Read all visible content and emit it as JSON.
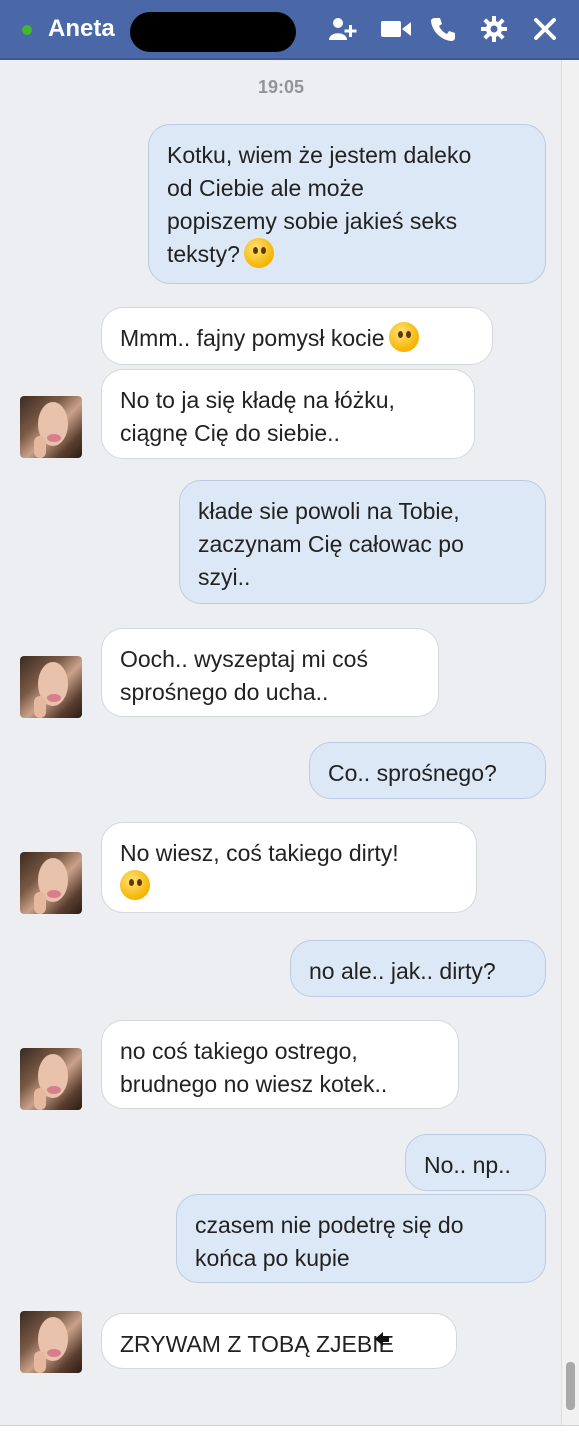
{
  "header": {
    "contact_name": "Aneta",
    "status": "online",
    "icons": [
      "add-people-icon",
      "video-call-icon",
      "phone-icon",
      "gear-icon",
      "close-icon"
    ]
  },
  "conversation": {
    "timestamp": "19:05",
    "messages": [
      {
        "from": "me",
        "text": "Kotku, wiem że jestem daleko\nod Ciebie ale może\npopiszemy sobie jakieś seks\nteksty?",
        "emoji": "wink"
      },
      {
        "from": "them",
        "text": "Mmm.. fajny pomysł kocie",
        "emoji": "kiss"
      },
      {
        "from": "them",
        "text": "No to ja się kładę na łóżku,\nciągnę Cię do siebie.."
      },
      {
        "from": "me",
        "text": "kłade sie powoli na Tobie,\nzaczynam Cię całowac po\nszyi.."
      },
      {
        "from": "them",
        "text": "Ooch.. wyszeptaj mi coś\nsprośnego do ucha.."
      },
      {
        "from": "me",
        "text": "Co.. sprośnego?"
      },
      {
        "from": "them",
        "text": "No wiesz, coś takiego dirty!",
        "emoji": "smile"
      },
      {
        "from": "me",
        "text": "no ale.. jak.. dirty?"
      },
      {
        "from": "them",
        "text": "no coś takiego ostrego,\nbrudnego no wiesz kotek.."
      },
      {
        "from": "me",
        "text": "No.. np.."
      },
      {
        "from": "me",
        "text": "czasem nie podetrę się do\nkońca po kupie"
      },
      {
        "from": "them",
        "text": "ZRYWAM Z TOBĄ ZJEBIE"
      }
    ]
  },
  "colors": {
    "header_bg": "#4a67a8",
    "outgoing_bubble": "#dce8f6",
    "incoming_bubble": "#ffffff",
    "online_dot": "#42b72a"
  }
}
